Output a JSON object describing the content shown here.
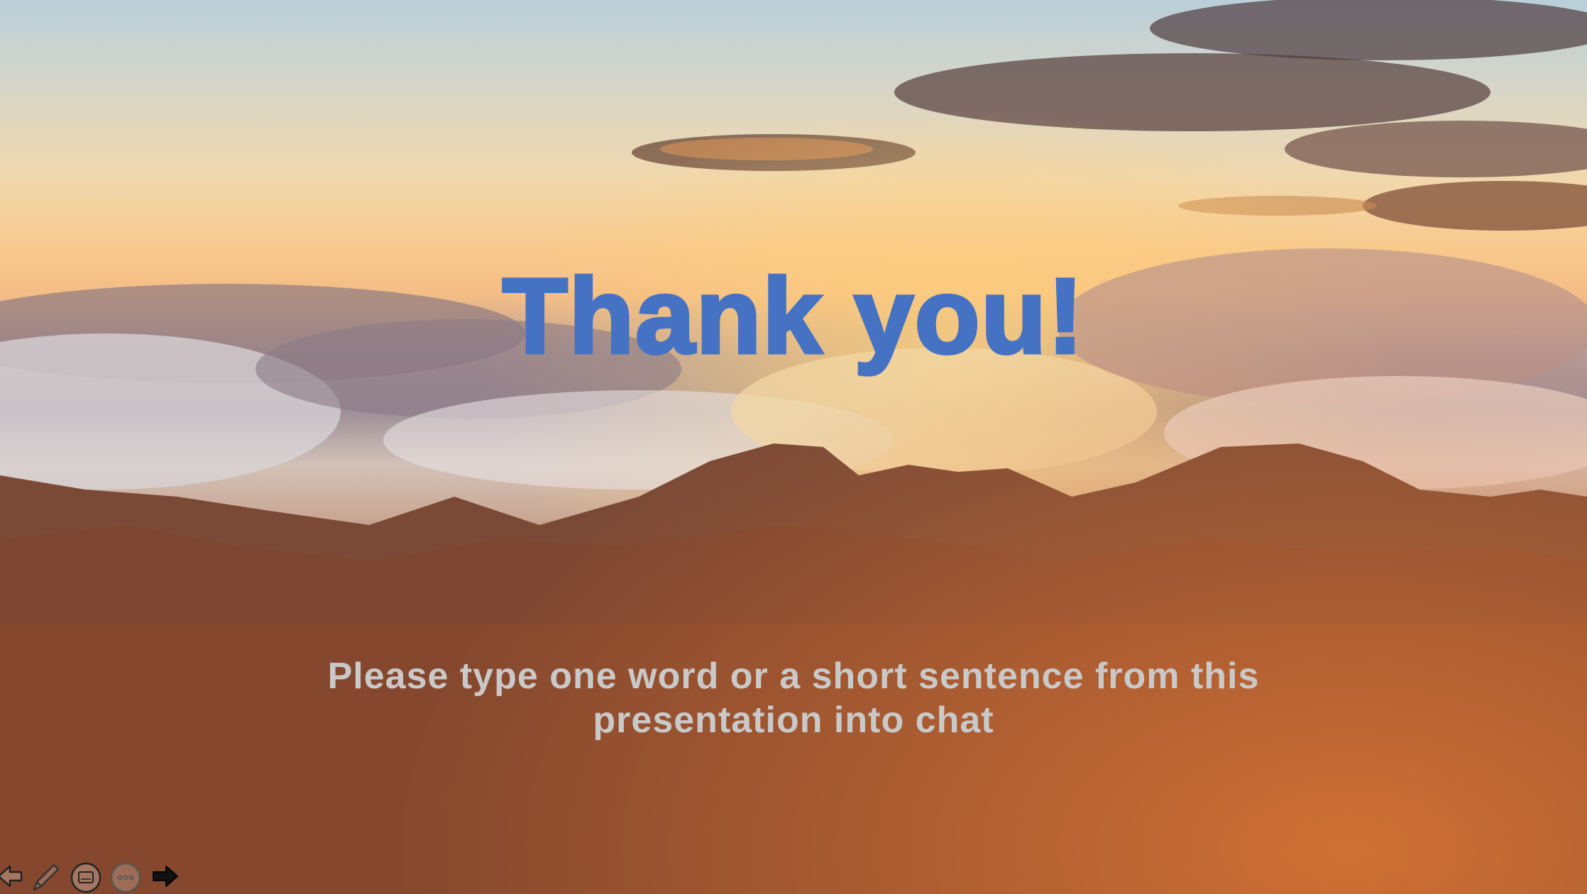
{
  "slide": {
    "title": "Thank you!",
    "subtitle_line1": "Please type one word or a short sentence from this",
    "subtitle_line2": "presentation into chat"
  },
  "toolbar": {
    "buttons": [
      {
        "icon": "previous-arrow-icon"
      },
      {
        "icon": "pen-icon"
      },
      {
        "icon": "slides-view-icon"
      },
      {
        "icon": "more-options-icon"
      },
      {
        "icon": "next-arrow-icon"
      }
    ]
  },
  "colors": {
    "title": "#4672c4",
    "subtitle": "#c9c9c9"
  }
}
